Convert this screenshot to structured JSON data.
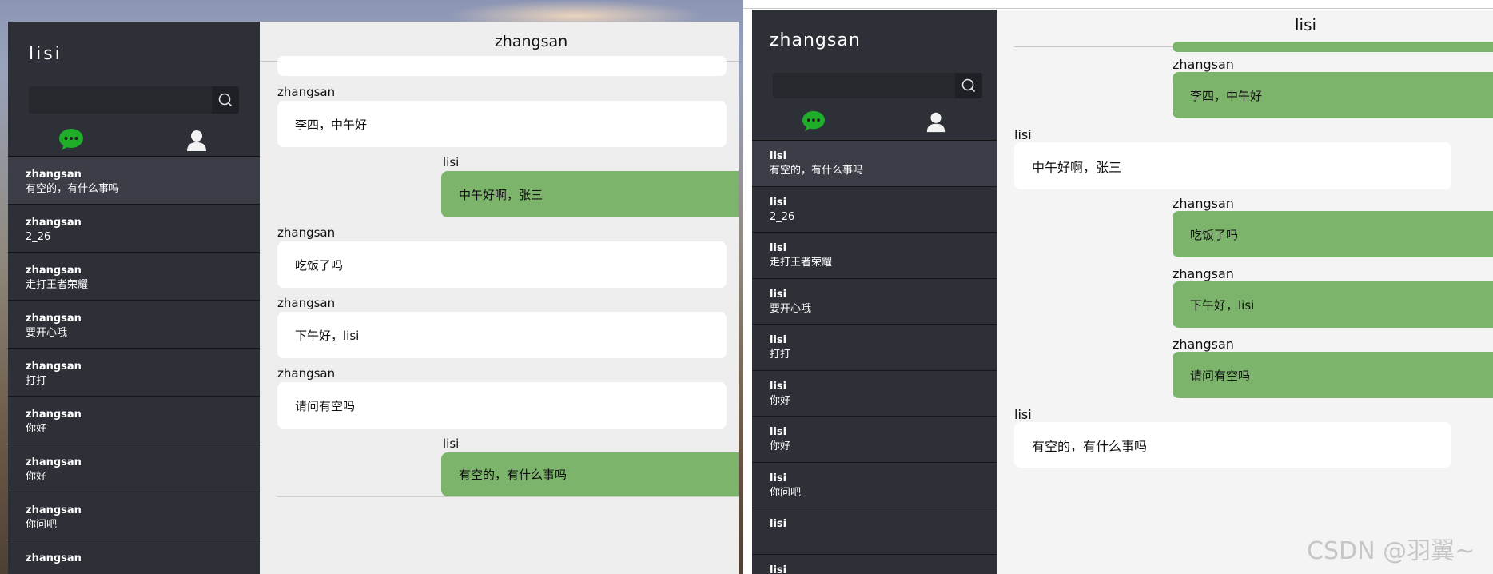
{
  "left_window": {
    "user_name": "lisi",
    "search": {
      "value": "",
      "placeholder": ""
    },
    "chat_title": "zhangsan",
    "conversations": [
      {
        "name": "zhangsan",
        "preview": "有空的，有什么事吗"
      },
      {
        "name": "zhangsan",
        "preview": "2_26"
      },
      {
        "name": "zhangsan",
        "preview": "走打王者荣耀"
      },
      {
        "name": "zhangsan",
        "preview": "要开心哦"
      },
      {
        "name": "zhangsan",
        "preview": "打打"
      },
      {
        "name": "zhangsan",
        "preview": "你好"
      },
      {
        "name": "zhangsan",
        "preview": "你好"
      },
      {
        "name": "zhangsan",
        "preview": "你问吧"
      },
      {
        "name": "zhangsan",
        "preview": ""
      }
    ],
    "messages": [
      {
        "sender": "",
        "text": "",
        "side": "left"
      },
      {
        "sender": "zhangsan",
        "text": "李四，中午好",
        "side": "left"
      },
      {
        "sender": "lisi",
        "text": "中午好啊，张三",
        "side": "right"
      },
      {
        "sender": "zhangsan",
        "text": "吃饭了吗",
        "side": "left"
      },
      {
        "sender": "zhangsan",
        "text": "下午好，lisi",
        "side": "left"
      },
      {
        "sender": "zhangsan",
        "text": "请问有空吗",
        "side": "left"
      },
      {
        "sender": "lisi",
        "text": "有空的，有什么事吗",
        "side": "right"
      }
    ]
  },
  "right_window": {
    "user_name": "zhangsan",
    "search": {
      "value": "",
      "placeholder": ""
    },
    "chat_title": "lisi",
    "conversations": [
      {
        "name": "lisi",
        "preview": "有空的，有什么事吗"
      },
      {
        "name": "lisi",
        "preview": "2_26"
      },
      {
        "name": "lisi",
        "preview": "走打王者荣耀"
      },
      {
        "name": "lisi",
        "preview": "要开心哦"
      },
      {
        "name": "lisi",
        "preview": "打打"
      },
      {
        "name": "lisi",
        "preview": "你好"
      },
      {
        "name": "lisi",
        "preview": "你好"
      },
      {
        "name": "lisi",
        "preview": "你问吧"
      },
      {
        "name": "lisi",
        "preview": ""
      },
      {
        "name": "lisi",
        "preview": ""
      }
    ],
    "messages": [
      {
        "sender": "",
        "text": "",
        "side": "right"
      },
      {
        "sender": "zhangsan",
        "text": "李四，中午好",
        "side": "right"
      },
      {
        "sender": "lisi",
        "text": "中午好啊，张三",
        "side": "left"
      },
      {
        "sender": "zhangsan",
        "text": "吃饭了吗",
        "side": "right"
      },
      {
        "sender": "zhangsan",
        "text": "下午好，lisi",
        "side": "right"
      },
      {
        "sender": "zhangsan",
        "text": "请问有空吗",
        "side": "right"
      },
      {
        "sender": "lisi",
        "text": "有空的，有什么事吗",
        "side": "left"
      }
    ]
  },
  "watermark": "CSDN @羽翼~",
  "icons": {
    "search": "search-icon",
    "chat": "chat-bubble-icon",
    "contacts": "user-icon"
  },
  "colors": {
    "sidebar": "#2e3038",
    "chat_bg": "#eeeeee",
    "green_bubble": "#7db46c",
    "white_bubble": "#ffffff",
    "chat_icon_green": "#1fae2a"
  }
}
